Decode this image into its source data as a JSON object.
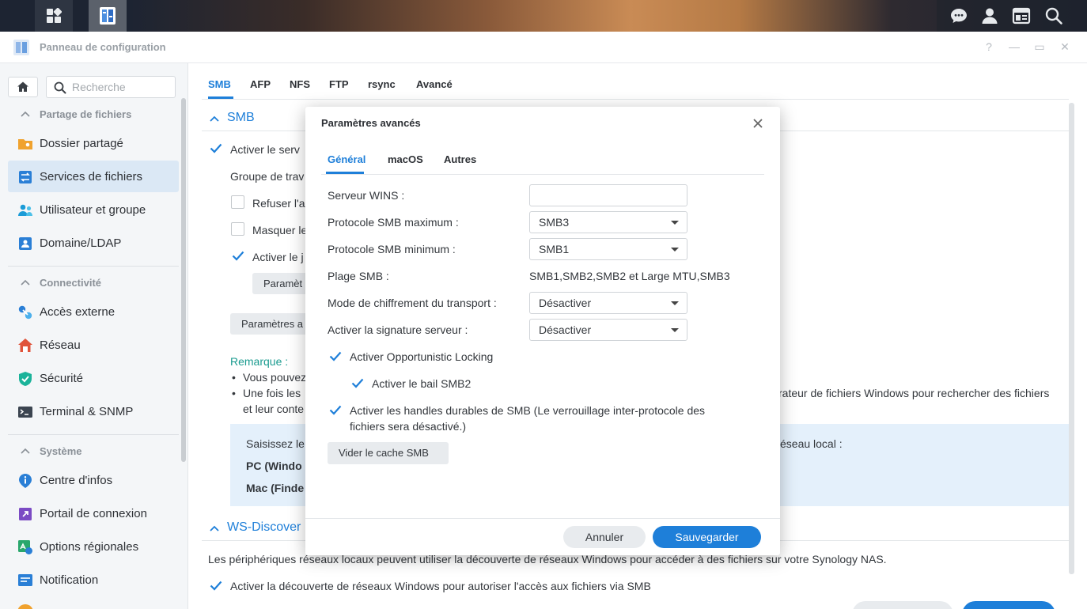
{
  "window": {
    "title": "Panneau de configuration",
    "controls": [
      "?",
      "—",
      "▭",
      "✕"
    ]
  },
  "taskbar": {
    "left_icons": [
      "grid-icon",
      "control-panel-app-icon"
    ],
    "right_icons": [
      "chat-icon",
      "user-icon",
      "widgets-icon",
      "search-icon"
    ]
  },
  "sidebar": {
    "search_placeholder": "Recherche",
    "sections": [
      {
        "label": "Partage de fichiers",
        "items": [
          {
            "label": "Dossier partagé",
            "icon": "folder-share-icon"
          },
          {
            "label": "Services de fichiers",
            "icon": "file-services-icon",
            "active": true
          },
          {
            "label": "Utilisateur et groupe",
            "icon": "users-icon"
          },
          {
            "label": "Domaine/LDAP",
            "icon": "domain-icon"
          }
        ]
      },
      {
        "label": "Connectivité",
        "items": [
          {
            "label": "Accès externe",
            "icon": "external-access-icon"
          },
          {
            "label": "Réseau",
            "icon": "network-icon"
          },
          {
            "label": "Sécurité",
            "icon": "security-shield-icon"
          },
          {
            "label": "Terminal & SNMP",
            "icon": "terminal-icon"
          }
        ]
      },
      {
        "label": "Système",
        "items": [
          {
            "label": "Centre d'infos",
            "icon": "info-center-icon"
          },
          {
            "label": "Portail de connexion",
            "icon": "login-portal-icon"
          },
          {
            "label": "Options régionales",
            "icon": "regional-options-icon"
          },
          {
            "label": "Notification",
            "icon": "notification-icon"
          }
        ]
      }
    ]
  },
  "main": {
    "tabs": [
      "SMB",
      "AFP",
      "NFS",
      "FTP",
      "rsync",
      "Avancé"
    ],
    "active_tab": "SMB",
    "smb_section": {
      "title": "SMB",
      "enable_service": "Activer le serv",
      "workgroup": "Groupe de trav",
      "refuse": "Refuser l'a",
      "hide": "Masquer le",
      "enable_log": "Activer le j",
      "params_btn_short": "Paramèt",
      "params_btn": "Paramètres a",
      "note_title": "Remarque :",
      "bullet1": "Vous pouvez",
      "bullet2_start": "Une fois les",
      "bullet2_end": "rateur de fichiers Windows pour rechercher des fichiers",
      "bullet2_line2": "et leur conte",
      "info_line1_start": "Saisissez le",
      "info_line1_end": "éseau local :",
      "info_pc": "PC (Windo",
      "info_mac": "Mac (Finde"
    },
    "ws_section": {
      "title": "WS-Discover",
      "description": "Les périphériques réseaux locaux peuvent utiliser la découverte de réseaux Windows pour accéder à des fichiers sur votre Synology NAS.",
      "enable": "Activer la découverte de réseaux Windows pour autoriser l'accès aux fichiers via SMB"
    }
  },
  "modal": {
    "title": "Paramètres avancés",
    "tabs": [
      "Général",
      "macOS",
      "Autres"
    ],
    "active_tab": "Général",
    "fields": {
      "wins_label": "Serveur WINS :",
      "wins_value": "",
      "smb_max_label": "Protocole SMB maximum :",
      "smb_max_value": "SMB3",
      "smb_min_label": "Protocole SMB minimum :",
      "smb_min_value": "SMB1",
      "smb_range_label": "Plage SMB :",
      "smb_range_value": "SMB1,SMB2,SMB2 et Large MTU,SMB3",
      "encryption_label": "Mode de chiffrement du transport :",
      "encryption_value": "Désactiver",
      "signing_label": "Activer la signature serveur :",
      "signing_value": "Désactiver"
    },
    "checkboxes": {
      "oplock": "Activer Opportunistic Locking",
      "smb2_lease": "Activer le bail SMB2",
      "durable_line1": "Activer les handles durables de SMB (Le verrouillage inter-protocole des",
      "durable_line2": "fichiers sera désactivé.)"
    },
    "clear_cache_btn": "Vider le cache SMB",
    "cancel_btn": "Annuler",
    "save_btn": "Sauvegarder"
  },
  "colors": {
    "accent": "#1e7fd9",
    "sidebar_active": "#dbe8f5",
    "info_box": "#e4f0fb"
  }
}
